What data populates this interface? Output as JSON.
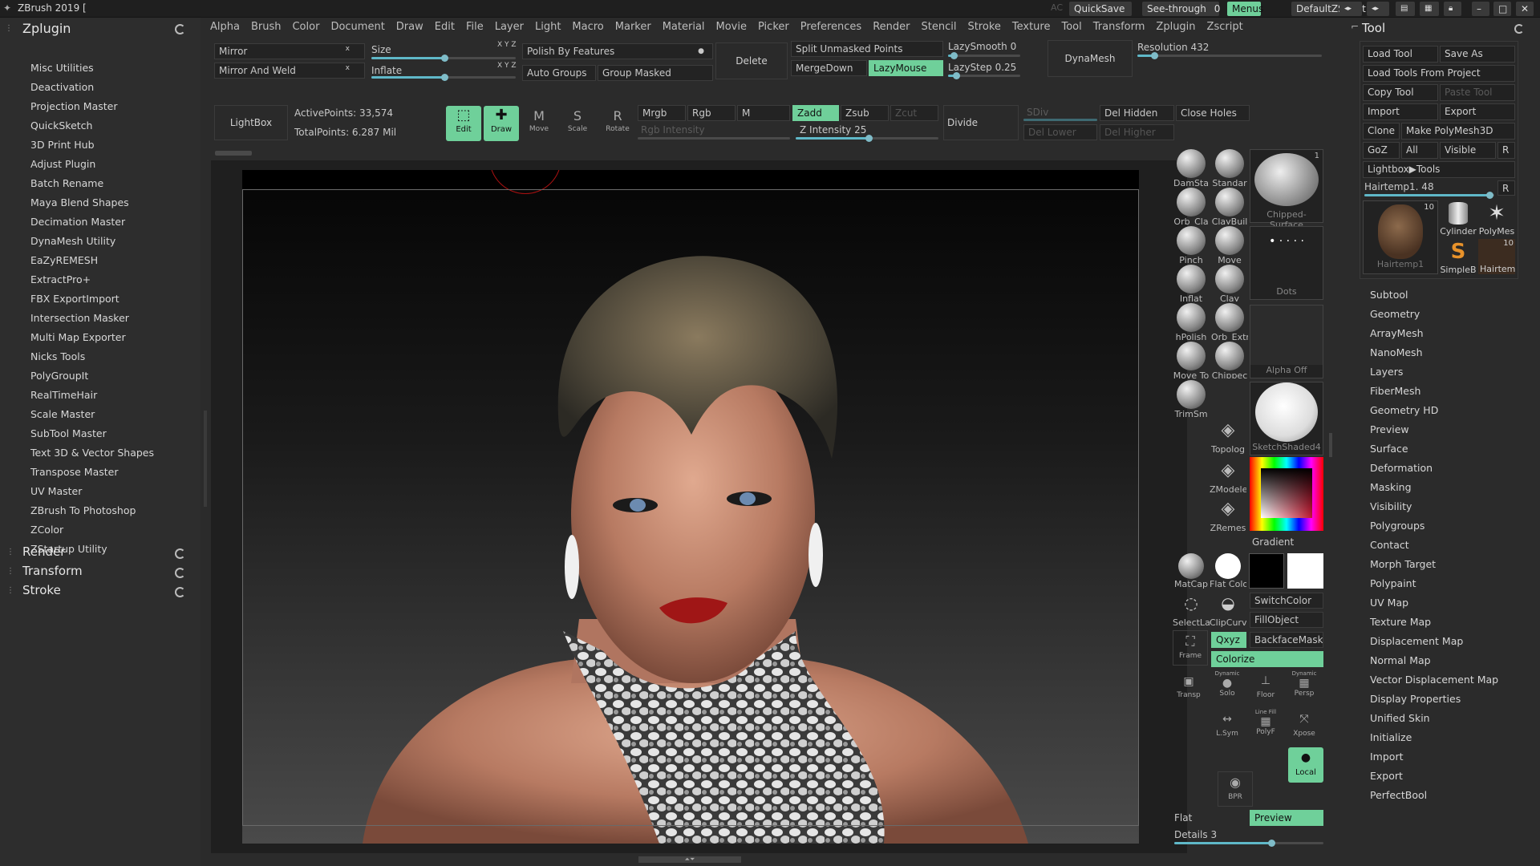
{
  "app": {
    "title": "ZBrush 2019 ["
  },
  "titlebar": {
    "ac": "AC",
    "quicksave": "QuickSave",
    "seethrough": "See-through",
    "seethrough_value": "0",
    "menus": "Menus",
    "script": "DefaultZScript"
  },
  "menubar": [
    "Alpha",
    "Brush",
    "Color",
    "Document",
    "Draw",
    "Edit",
    "File",
    "Layer",
    "Light",
    "Macro",
    "Marker",
    "Material",
    "Movie",
    "Picker",
    "Preferences",
    "Render",
    "Stencil",
    "Stroke",
    "Texture",
    "Tool",
    "Transform",
    "Zplugin",
    "Zscript"
  ],
  "left_panel": {
    "header": "Zplugin",
    "items": [
      "Misc Utilities",
      "Deactivation",
      "Projection Master",
      "QuickSketch",
      "3D Print Hub",
      "Adjust Plugin",
      "Batch Rename",
      "Maya Blend Shapes",
      "Decimation Master",
      "DynaMesh Utility",
      "EaZyREMESH",
      "ExtractPro+",
      "FBX ExportImport",
      "Intersection Masker",
      "Multi Map Exporter",
      "Nicks Tools",
      "PolyGroupIt",
      "RealTimeHair",
      "Scale Master",
      "SubTool Master",
      "Text 3D & Vector Shapes",
      "Transpose Master",
      "UV Master",
      "ZBrush To Photoshop",
      "ZColor",
      "ZStartup Utility"
    ],
    "sections": [
      "Render",
      "Transform",
      "Stroke"
    ]
  },
  "toolbar": {
    "mirror": "Mirror",
    "mirror_weld": "Mirror And Weld",
    "size": "Size",
    "inflate": "Inflate",
    "xyz": "X Y Z",
    "polish": "Polish By Features",
    "auto_groups": "Auto Groups",
    "group_masked": "Group Masked",
    "delete": "Delete",
    "split_unmasked": "Split Unmasked Points",
    "merge_down": "MergeDown",
    "lazymouse": "LazyMouse",
    "lazysmooth": "LazySmooth",
    "lazysmooth_value": "0",
    "lazystep": "LazyStep",
    "lazystep_value": "0.25",
    "dynamesh": "DynaMesh",
    "resolution": "Resolution",
    "resolution_value": "432",
    "lightbox": "LightBox",
    "active_points": "ActivePoints: 33,574",
    "total_points": "TotalPoints: 6.287 Mil",
    "edit": "Edit",
    "draw": "Draw",
    "move": "Move",
    "scale": "Scale",
    "rotate": "Rotate",
    "mrgb": "Mrgb",
    "rgb": "Rgb",
    "m": "M",
    "zadd": "Zadd",
    "zsub": "Zsub",
    "zcut": "Zcut",
    "rgb_intensity": "Rgb Intensity",
    "z_intensity": "Z Intensity",
    "z_intensity_value": "25",
    "divide": "Divide",
    "sdiv": "SDiv",
    "del_lower": "Del Lower",
    "del_higher": "Del Higher",
    "del_hidden": "Del Hidden",
    "close_holes": "Close Holes"
  },
  "shelf": {
    "brushes": [
      "DamSta",
      "Standar",
      "Orb_Cla",
      "ClayBuil",
      "Pinch",
      "Move",
      "Inflat",
      "Clay",
      "hPolish",
      "Orb_Extr",
      "Move To",
      "Chippec",
      "TrimSm"
    ],
    "chipped_surface": "Chipped-Surface",
    "dots": "Dots",
    "alpha_off": "Alpha Off",
    "sketch_shaded": "SketchShaded4",
    "topology": "Topolog",
    "zmodeler": "ZModele",
    "zremesh": "ZRemes",
    "gradient": "Gradient",
    "matcap": "MatCap",
    "flat_color": "Flat Colo",
    "switch_color": "SwitchColor",
    "fill_object": "FillObject",
    "select_lasso": "SelectLa",
    "clip_curve": "ClipCurv",
    "xyz": "Qxyz",
    "backface_mask": "BackfaceMask",
    "colorize": "Colorize",
    "frame": "Frame",
    "transp": "Transp",
    "dynamic_solo": "Dynamic",
    "solo": "Solo",
    "floor": "Floor",
    "persp": "Persp",
    "lsym": "L.Sym",
    "polyf": "PolyF",
    "line_fill": "Line Fill",
    "xpose": "Xpose",
    "local": "Local",
    "bpr": "BPR",
    "flat": "Flat",
    "preview": "Preview",
    "details": "Details",
    "details_value": "3",
    "hub_badge": "1"
  },
  "tool_panel": {
    "title": "Tool",
    "load_tool": "Load Tool",
    "save_as": "Save As",
    "load_from_project": "Load Tools From Project",
    "copy_tool": "Copy Tool",
    "paste_tool": "Paste Tool",
    "import": "Import",
    "export": "Export",
    "clone": "Clone",
    "make_polymesh": "Make PolyMesh3D",
    "goz": "GoZ",
    "all": "All",
    "visible": "Visible",
    "r": "R",
    "lightbox_tools": "Lightbox▶Tools",
    "hairtemp": "Hairtemp1. 48",
    "thumb_badge": "10",
    "thumbs": [
      "Hairtemp1",
      "Cylinder",
      "PolyMes",
      "SimpleB",
      "Hairtem"
    ],
    "items": [
      "Subtool",
      "Geometry",
      "ArrayMesh",
      "NanoMesh",
      "Layers",
      "FiberMesh",
      "Geometry HD",
      "Preview",
      "Surface",
      "Deformation",
      "Masking",
      "Visibility",
      "Polygroups",
      "Contact",
      "Morph Target",
      "Polypaint",
      "UV Map",
      "Texture Map",
      "Displacement Map",
      "Normal Map",
      "Vector Displacement Map",
      "Display Properties",
      "Unified Skin",
      "Initialize",
      "Import",
      "Export",
      "PerfectBool"
    ]
  },
  "colors": {
    "accent": "#6fd09a",
    "slider": "#5fb8c8"
  }
}
